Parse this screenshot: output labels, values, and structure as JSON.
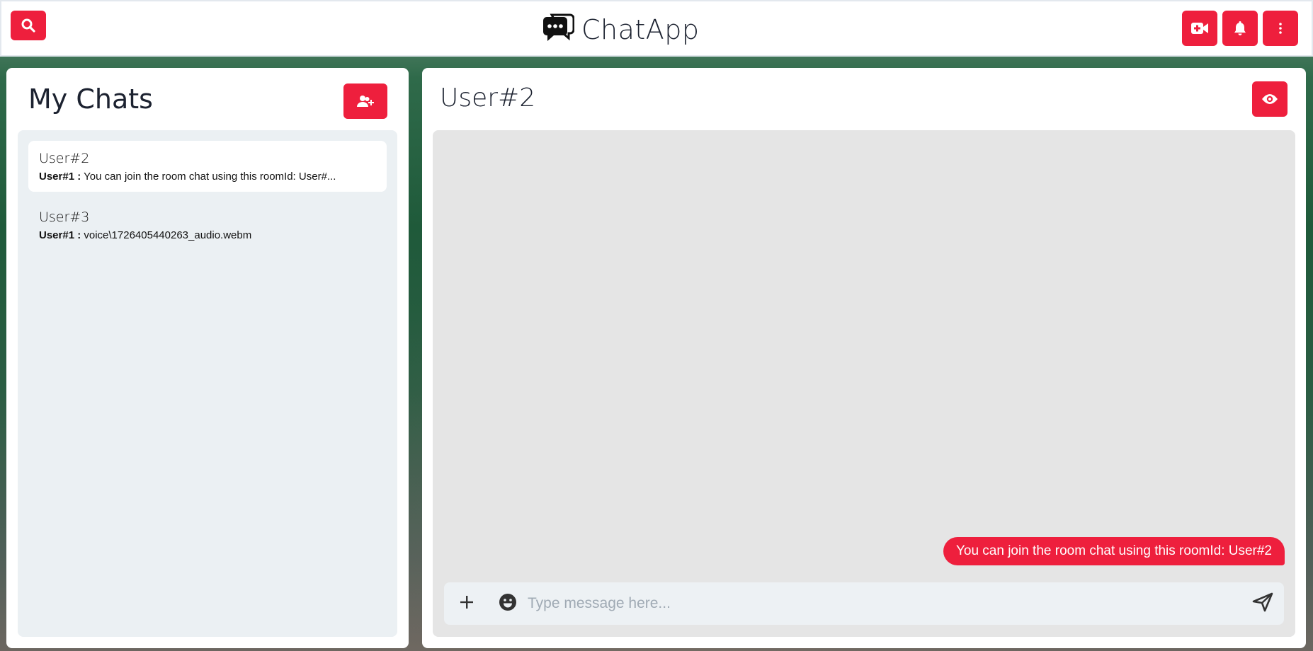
{
  "app": {
    "title": "ChatApp",
    "brand_icon": "chat-bubbles-icon",
    "accent_color": "#ee1f3d"
  },
  "header": {
    "search_icon": "search-icon",
    "actions": [
      {
        "name": "video-call",
        "icon": "video-plus-icon"
      },
      {
        "name": "notifications",
        "icon": "bell-icon"
      },
      {
        "name": "more-options",
        "icon": "vertical-dots-icon"
      }
    ]
  },
  "sidebar": {
    "title": "My Chats",
    "new_group_icon": "add-user-icon",
    "chats": [
      {
        "name": "User#2",
        "last_sender": "User#1 :",
        "last_message": "You can join the room chat using this roomId: User#...",
        "active": true
      },
      {
        "name": "User#3",
        "last_sender": "User#1 :",
        "last_message": "voice\\1726405440263_audio.webm",
        "active": false
      }
    ]
  },
  "conversation": {
    "title": "User#2",
    "view_profile_icon": "eye-icon",
    "messages": [
      {
        "text": "You can join the room chat using this roomId: User#2",
        "own": true
      }
    ],
    "composer": {
      "attach_icon": "plus-icon",
      "emoji_icon": "smiley-icon",
      "placeholder": "Type message here...",
      "value": "",
      "send_icon": "send-icon"
    }
  }
}
